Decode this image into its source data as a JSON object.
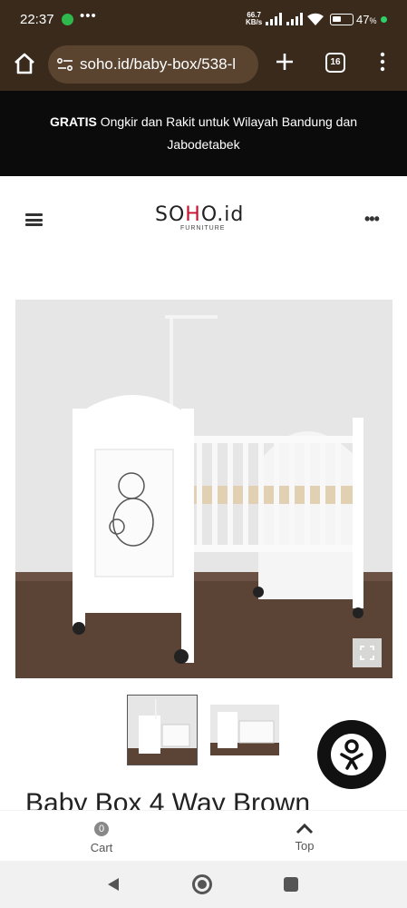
{
  "status_bar": {
    "time": "22:37",
    "dots": "•••",
    "net_speed_value": "66.7",
    "net_speed_unit": "KB/s",
    "battery_percent": "47",
    "battery_unit": "%",
    "battery_level": 0.47
  },
  "browser": {
    "url": "soho.id/baby-box/538-l",
    "tab_count": "16"
  },
  "announcement": {
    "bold": "GRATIS",
    "text": " Ongkir dan Rakit untuk Wilayah Bandung dan Jabodetabek"
  },
  "header": {
    "logo_prefix": "S",
    "logo_o": "O",
    "logo_h": "H",
    "logo_o2": "O",
    "logo_suffix": ".id",
    "logo_sub": "FURNITURE",
    "more": "•••"
  },
  "product": {
    "title": "Baby Box 4 Way Brown"
  },
  "bottom_nav": {
    "cart_count": "0",
    "cart_label": "Cart",
    "top_label": "Top"
  },
  "colors": {
    "browser_bg": "#3a2a1c",
    "announce_bg": "#0b0b0b",
    "logo_accent": "#c8102e"
  }
}
